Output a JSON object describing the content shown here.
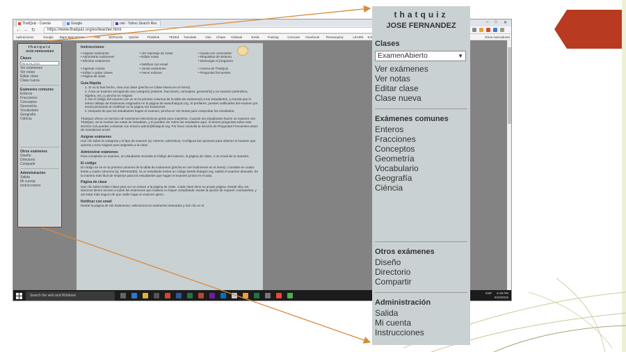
{
  "browser": {
    "tabs": [
      {
        "title": "ThatQuiz - Cuenta",
        "active": true
      },
      {
        "title": "Google",
        "active": false
      },
      {
        "title": "owl - Yahoo Search Res",
        "active": false
      }
    ],
    "url": "https://www.thatquiz.org/es/teacher.html",
    "bookmarks": [
      "Aplicaciones",
      "Google",
      "Bajar Marcadores",
      "Pixlr",
      "EDPuzzle",
      "Quizlet",
      "Thinklink",
      "TEDEd",
      "Translate",
      "One",
      "Chase",
      "Citibank",
      "iSmile",
      "Training",
      "Comcast",
      "Facebook",
      "Teresarquisy",
      "LEARN",
      "SJSU",
      "ESL"
    ],
    "bookmarks_right": "Otros marcadores"
  },
  "thatquiz": {
    "brand": "thatquiz",
    "user": "JOSE FERNANDEZ",
    "classes_heading": "Clases",
    "class_selected": "ExamenAbierto",
    "mini_class_selected": "TRI N-FA-2015",
    "class_links": [
      "Ver exámenes",
      "Ver notas",
      "Editar clase",
      "Clase nueva"
    ],
    "common_heading": "Exámenes comunes",
    "common_links": [
      "Enteros",
      "Fracciones",
      "Conceptos",
      "Geometría",
      "Vocabulario",
      "Geografía",
      "Ciéncia"
    ],
    "other_heading": "Otros exámenes",
    "other_links": [
      "Diseño",
      "Directorio",
      "Compartir"
    ],
    "admin_heading": "Administración",
    "admin_links": [
      "Salida",
      "Mi cuenta",
      "Instrucciones"
    ]
  },
  "main": {
    "instructions_title": "Instrucciones",
    "instr_col1": [
      "Asignar exámenes",
      "Administrar exámenes",
      "Eliminar exámenes",
      "",
      "Ingresar cursos",
      "Editar o quitar clases",
      "Página de clase"
    ],
    "instr_col2": [
      "Ver reportaje de notas",
      "Editar notas",
      "",
      "Notificar con email",
      "Juntar exámenes",
      "Hacer enlaces"
    ],
    "instr_col3": [
      "Ayuda con conectarse",
      "Requisitos de sistema",
      "Descargar el programa",
      "",
      "Acerca de ThatQuiz",
      "Preguntas frecuentes"
    ],
    "quick_title": "Guía Rápida",
    "quick_steps": [
      "1. Si no lo has hecho, crea una clase (pincha en Clase Nueva en el menú).",
      "2. Crea un examen escogiendo una categoría (enteros, fracciones, conceptos, geometría) y un examen (aritmética, álgebra, etc.) y pincha en Asignar.",
      "3. Da el código del examen (se ve en la primera columna de la tabla de exámenes) a tus estudiantes, y manda que lo entren debajo de Exámenes Asignados en la página de www.thatquiz.org. Si prefieres, puedes notificarles del examen por email pinchando en Notificar en la página Ver Exámenes.",
      "4. Después de que los estudiantes hagan el examen, pincha en Ver Notas para comprobar los resultados."
    ],
    "intro": "ThatQuiz ofrece un servicio de exámenes electrónicos gratis para maestros. Cuando tus estudiantes hacen un examen con ThatQuiz, se te revelan las notas de inmediato, y tú puedes ver todos los resultados aquí. Si tienes preguntas sobre este servicio nos puedes contactar con email a admin@thatquiz.org. Por favor consulta la sección de Preguntas Frecuentes antes de mandarnos email.",
    "sections": [
      {
        "title": "Asignar exámenes",
        "body": "Haz clic sobre la categoría y el tipo de examen (ej. enteros, aritmética). Configura las opciones para obtener el examen que quieras y toca Asignar para asignarlo a la clase."
      },
      {
        "title": "Administrar exámenes",
        "body": "Para completar un examen, un estudiante necesita el código del examen, la página de clase, o un email de tu maestro."
      },
      {
        "title": "El código",
        "body": "El código se ve en la primera columna de la tabla de exámenes (pincha en Ver Exámenes en el menú). Consiste en cuatro letras y cuatro números (ej. MPAK5283). Si un estudiante teclea un código desde thatquiz.org, saldrá el examen deseado. Es la manera más fácil de empezar para los estudiantes que hagan el examen juntos en el aula."
      },
      {
        "title": "Página de clase",
        "body": "Haz clic sobre Editar Clase para ver un enlace a la página de clase. Cada clase tiene su propia página. Desde ella, los alumnos tienen acceso a todos los exámenes que todavía no hayan completado. Existe la opción de requerir contraseñas, y así estar más seguro de que nadie haga un examen ajeno."
      },
      {
        "title": "Notificar con email",
        "body": "Desde la página de Ver Exámenes, selecciona los exámenes deseados y haz clic en el"
      }
    ]
  },
  "taskbar": {
    "search_placeholder": "Search the web and Windows",
    "lang": "ESP",
    "time": "6:19 PM",
    "date": "9/10/2015"
  },
  "colors": {
    "panel_bg": "#c9d1d3",
    "arrow": "#d98a3a",
    "accent_red": "#b83a20",
    "highlight_border": "#9a2a1e"
  }
}
